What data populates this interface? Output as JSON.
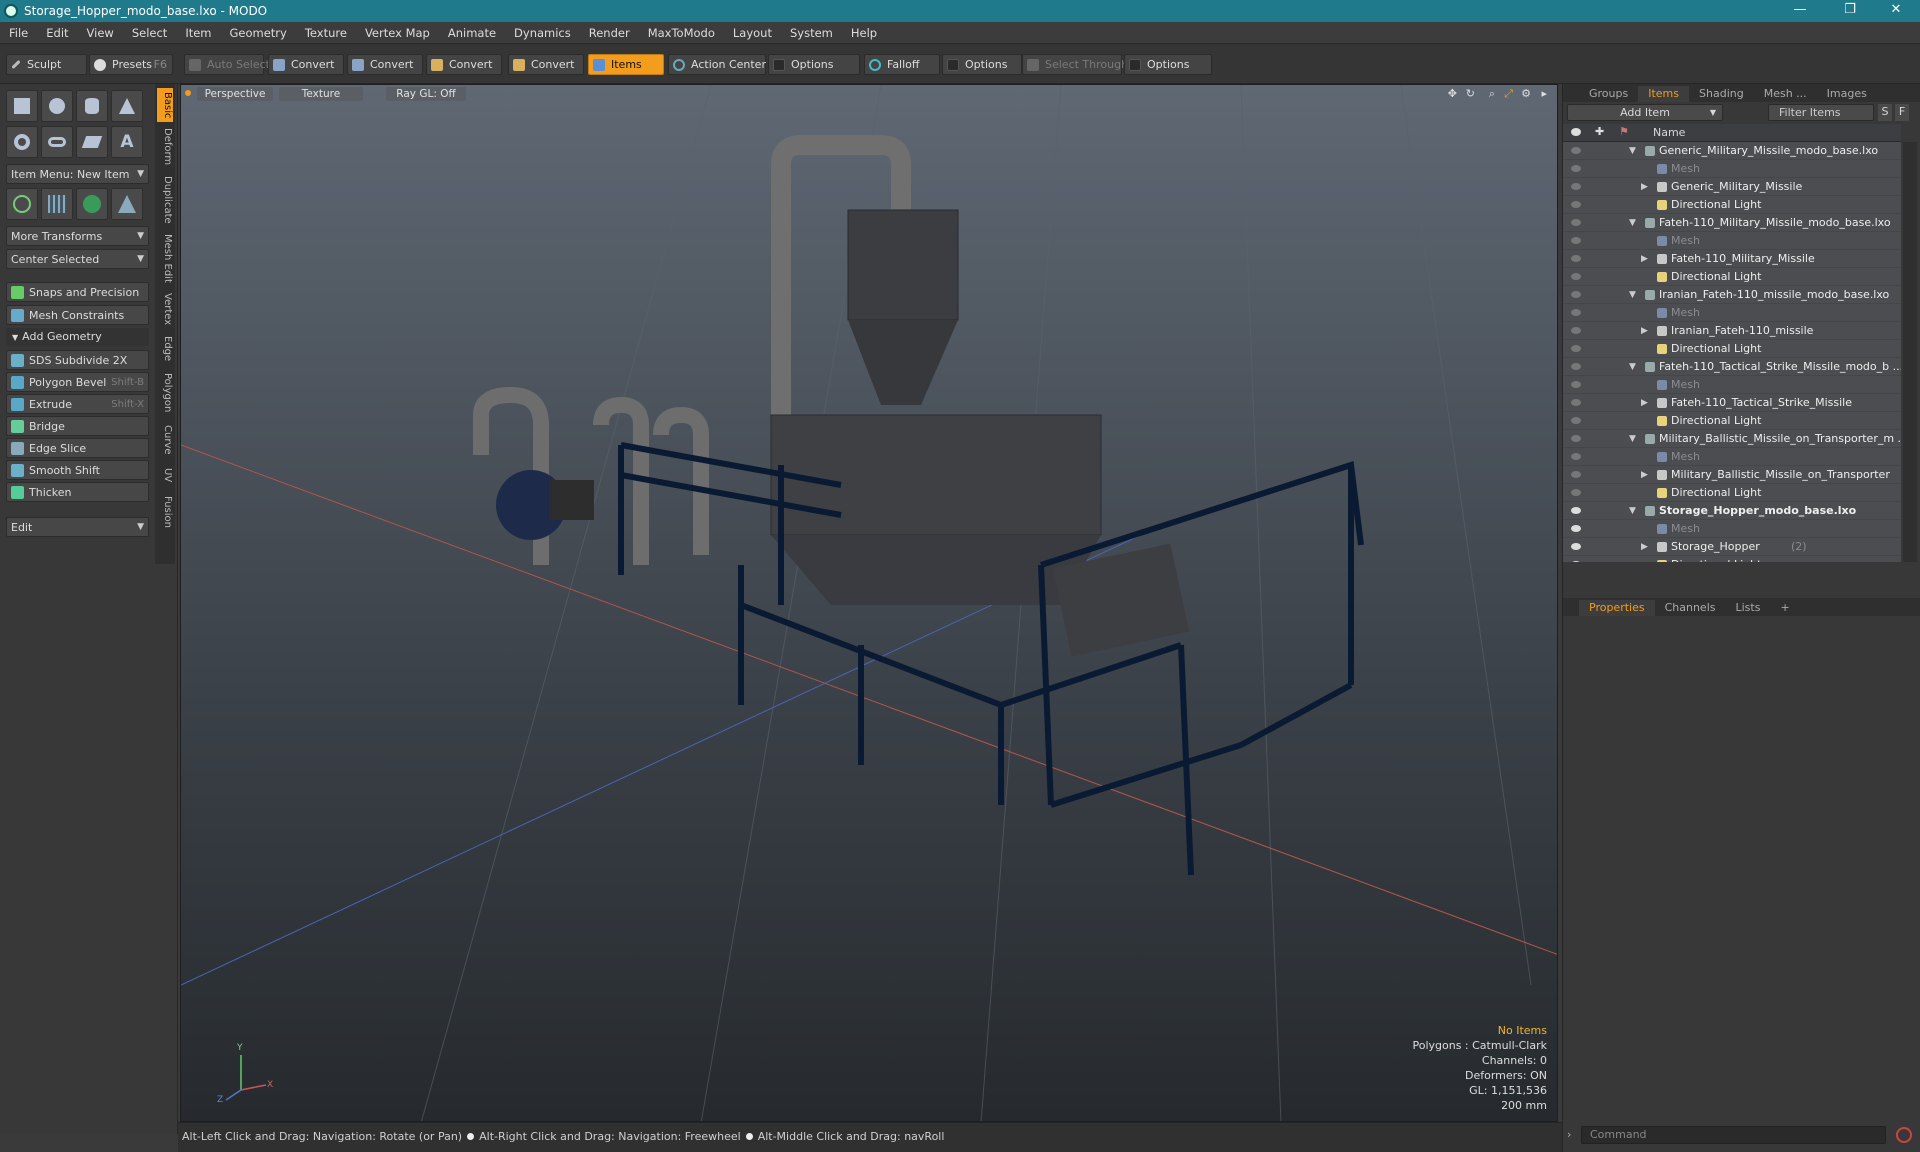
{
  "window": {
    "title": "Storage_Hopper_modo_base.lxo - MODO",
    "minimize": "—",
    "restore": "❐",
    "close": "✕"
  },
  "menu": [
    "File",
    "Edit",
    "View",
    "Select",
    "Item",
    "Geometry",
    "Texture",
    "Vertex Map",
    "Animate",
    "Dynamics",
    "Render",
    "MaxToModo",
    "Layout",
    "System",
    "Help"
  ],
  "toolbar": {
    "sculpt": "Sculpt",
    "presets": "Presets",
    "presets_key": "F6",
    "auto_select": "Auto Select",
    "convert1": "Convert",
    "convert2": "Convert",
    "convert3": "Convert",
    "convert4": "Convert",
    "items": "Items",
    "action_center": "Action Center",
    "options1": "Options",
    "falloff": "Falloff",
    "options2": "Options",
    "select_through": "Select Through",
    "options3": "Options"
  },
  "left": {
    "item_menu": "Item Menu: New Item",
    "more_transforms": "More Transforms",
    "center_selected": "Center Selected",
    "snaps": "Snaps and Precision",
    "mesh_constraints": "Mesh Constraints",
    "add_geometry": "Add Geometry",
    "tools": [
      {
        "label": "SDS Subdivide 2X",
        "key": ""
      },
      {
        "label": "Polygon Bevel",
        "key": "Shift-B"
      },
      {
        "label": "Extrude",
        "key": "Shift-X"
      },
      {
        "label": "Bridge",
        "key": ""
      },
      {
        "label": "Edge Slice",
        "key": ""
      },
      {
        "label": "Smooth Shift",
        "key": ""
      },
      {
        "label": "Thicken",
        "key": ""
      }
    ],
    "edit": "Edit",
    "vtabs": [
      "Basic",
      "Deform",
      "Duplicate",
      "Mesh Edit",
      "Vertex",
      "Edge",
      "Polygon",
      "Curve",
      "UV",
      "Fusion"
    ]
  },
  "viewport": {
    "view": "Perspective",
    "shading": "Texture",
    "raygl": "Ray GL: Off",
    "info": {
      "selection": "No Items",
      "polygons": "Polygons : Catmull-Clark",
      "channels": "Channels: 0",
      "deformers": "Deformers: ON",
      "gl": "GL: 1,151,536",
      "scale": "200 mm"
    },
    "axis": {
      "y": "Y",
      "x": "X",
      "z": "Z"
    }
  },
  "status": {
    "hint1": "Alt-Left Click and Drag: Navigation: Rotate (or Pan)",
    "hint2": "Alt-Right Click and Drag: Navigation: Freewheel",
    "hint3": "Alt-Middle Click and Drag: navRoll"
  },
  "items_panel": {
    "tabs": [
      "Groups",
      "Items",
      "Shading",
      "Mesh ...",
      "Images"
    ],
    "add_item": "Add Item",
    "filter": "Filter Items",
    "btn_s": "S",
    "btn_f": "F",
    "col_name": "Name",
    "rows": [
      {
        "label": "Generic_Military_Missile_modo_base.lxo",
        "type": "scene",
        "level": 0,
        "eye": false
      },
      {
        "label": "Mesh",
        "type": "mesh",
        "level": 1,
        "eye": false,
        "dim": true
      },
      {
        "label": "Generic_Military_Missile",
        "type": "group",
        "level": 1,
        "eye": false
      },
      {
        "label": "Directional Light",
        "type": "light",
        "level": 1,
        "eye": false
      },
      {
        "label": "Fateh-110_Military_Missile_modo_base.lxo",
        "type": "scene",
        "level": 0,
        "eye": false
      },
      {
        "label": "Mesh",
        "type": "mesh",
        "level": 1,
        "eye": false,
        "dim": true
      },
      {
        "label": "Fateh-110_Military_Missile",
        "type": "group",
        "level": 1,
        "eye": false
      },
      {
        "label": "Directional Light",
        "type": "light",
        "level": 1,
        "eye": false
      },
      {
        "label": "Iranian_Fateh-110_missile_modo_base.lxo",
        "type": "scene",
        "level": 0,
        "eye": false
      },
      {
        "label": "Mesh",
        "type": "mesh",
        "level": 1,
        "eye": false,
        "dim": true
      },
      {
        "label": "Iranian_Fateh-110_missile",
        "type": "group",
        "level": 1,
        "eye": false
      },
      {
        "label": "Directional Light",
        "type": "light",
        "level": 1,
        "eye": false
      },
      {
        "label": "Fateh-110_Tactical_Strike_Missile_modo_b ...",
        "type": "scene",
        "level": 0,
        "eye": false
      },
      {
        "label": "Mesh",
        "type": "mesh",
        "level": 1,
        "eye": false,
        "dim": true
      },
      {
        "label": "Fateh-110_Tactical_Strike_Missile",
        "type": "group",
        "level": 1,
        "eye": false
      },
      {
        "label": "Directional Light",
        "type": "light",
        "level": 1,
        "eye": false
      },
      {
        "label": "Military_Ballistic_Missile_on_Transporter_m ...",
        "type": "scene",
        "level": 0,
        "eye": false
      },
      {
        "label": "Mesh",
        "type": "mesh",
        "level": 1,
        "eye": false,
        "dim": true
      },
      {
        "label": "Military_Ballistic_Missile_on_Transporter",
        "type": "group",
        "level": 1,
        "eye": false
      },
      {
        "label": "Directional Light",
        "type": "light",
        "level": 1,
        "eye": false
      },
      {
        "label": "Storage_Hopper_modo_base.lxo",
        "type": "scene",
        "level": 0,
        "eye": true,
        "bold": true
      },
      {
        "label": "Mesh",
        "type": "mesh",
        "level": 1,
        "eye": true,
        "dim": true
      },
      {
        "label": "Storage_Hopper",
        "type": "group",
        "level": 1,
        "eye": true,
        "count": "(2)"
      },
      {
        "label": "Directional Light",
        "type": "light",
        "level": 1,
        "eye": true
      }
    ]
  },
  "props_panel": {
    "tabs": [
      "Properties",
      "Channels",
      "Lists"
    ],
    "plus": "+"
  },
  "command": {
    "placeholder": "Command"
  },
  "colors": {
    "accent": "#f29d1d",
    "titlebar": "#1f7a8c",
    "frame": "#0b1a33"
  }
}
